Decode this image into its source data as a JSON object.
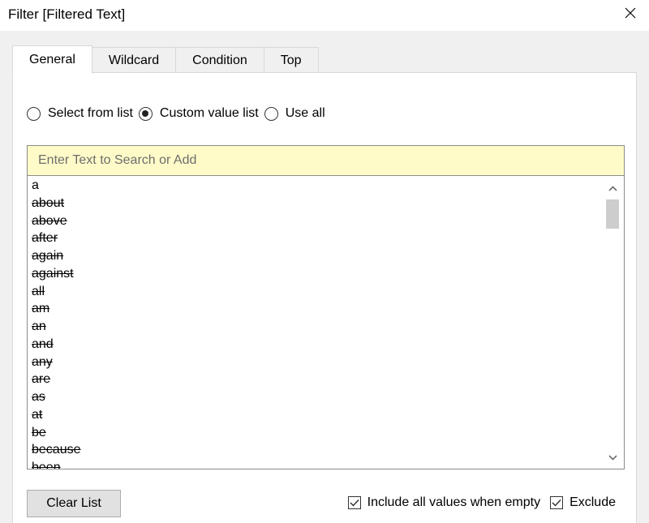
{
  "window": {
    "title": "Filter [Filtered Text]",
    "close_icon": "close-icon"
  },
  "tabs": [
    {
      "label": "General",
      "active": true
    },
    {
      "label": "Wildcard",
      "active": false
    },
    {
      "label": "Condition",
      "active": false
    },
    {
      "label": "Top",
      "active": false
    }
  ],
  "mode": {
    "options": [
      {
        "label": "Select from list",
        "checked": false
      },
      {
        "label": "Custom value list",
        "checked": true
      },
      {
        "label": "Use all",
        "checked": false
      }
    ]
  },
  "search": {
    "placeholder": "Enter Text to Search or Add",
    "value": "",
    "background": "#fffbc8"
  },
  "list": {
    "items": [
      {
        "text": "a",
        "struck": false
      },
      {
        "text": "about",
        "struck": true
      },
      {
        "text": "above",
        "struck": true
      },
      {
        "text": "after",
        "struck": true
      },
      {
        "text": "again",
        "struck": true
      },
      {
        "text": "against",
        "struck": true
      },
      {
        "text": "all",
        "struck": true
      },
      {
        "text": "am",
        "struck": true
      },
      {
        "text": "an",
        "struck": true
      },
      {
        "text": "and",
        "struck": true
      },
      {
        "text": "any",
        "struck": true
      },
      {
        "text": "are",
        "struck": true
      },
      {
        "text": "as",
        "struck": true
      },
      {
        "text": "at",
        "struck": true
      },
      {
        "text": "be",
        "struck": true
      },
      {
        "text": "because",
        "struck": true
      },
      {
        "text": "been",
        "struck": true
      }
    ],
    "scroll_up_icon": "chevron-up-icon",
    "scroll_down_icon": "chevron-down-icon"
  },
  "footer": {
    "clear_label": "Clear List",
    "include_all_label": "Include all values when empty",
    "include_all_checked": true,
    "exclude_label": "Exclude",
    "exclude_checked": true
  }
}
